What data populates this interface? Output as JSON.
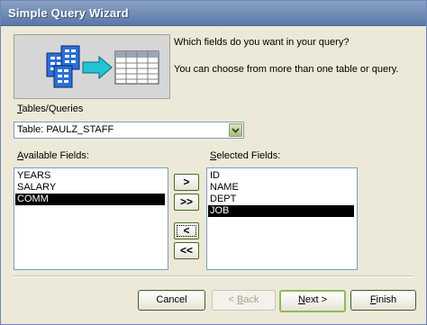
{
  "window": {
    "title": "Simple Query Wizard"
  },
  "intro": {
    "question": "Which fields do you want in your query?",
    "info": "You can choose from more than one table or query."
  },
  "tables_queries": {
    "label_accel": "T",
    "label_rest": "ables/Queries",
    "selected_value": "Table: PAULZ_STAFF"
  },
  "available_fields": {
    "label_accel": "A",
    "label_rest": "vailable Fields:",
    "items": [
      "YEARS",
      "SALARY",
      "COMM"
    ],
    "selected_index": 2
  },
  "selected_fields": {
    "label_accel": "S",
    "label_rest": "elected Fields:",
    "items": [
      "ID",
      "NAME",
      "DEPT",
      "JOB"
    ],
    "selected_index": 3
  },
  "move_buttons": {
    "add_one": ">",
    "add_all": ">>",
    "remove_one": "<",
    "remove_all": "<<"
  },
  "footer": {
    "cancel": "Cancel",
    "back_prefix": "< ",
    "back_accel": "B",
    "back_rest": "ack",
    "next_accel": "N",
    "next_rest": "ext >",
    "finish_accel": "F",
    "finish_rest": "inish"
  },
  "colors": {
    "title_bar": "#6f8ab8",
    "background": "#ece9d8",
    "selection": "#000000"
  },
  "icons": [
    "tables-to-grid-illustration",
    "dropdown-arrow-icon"
  ]
}
